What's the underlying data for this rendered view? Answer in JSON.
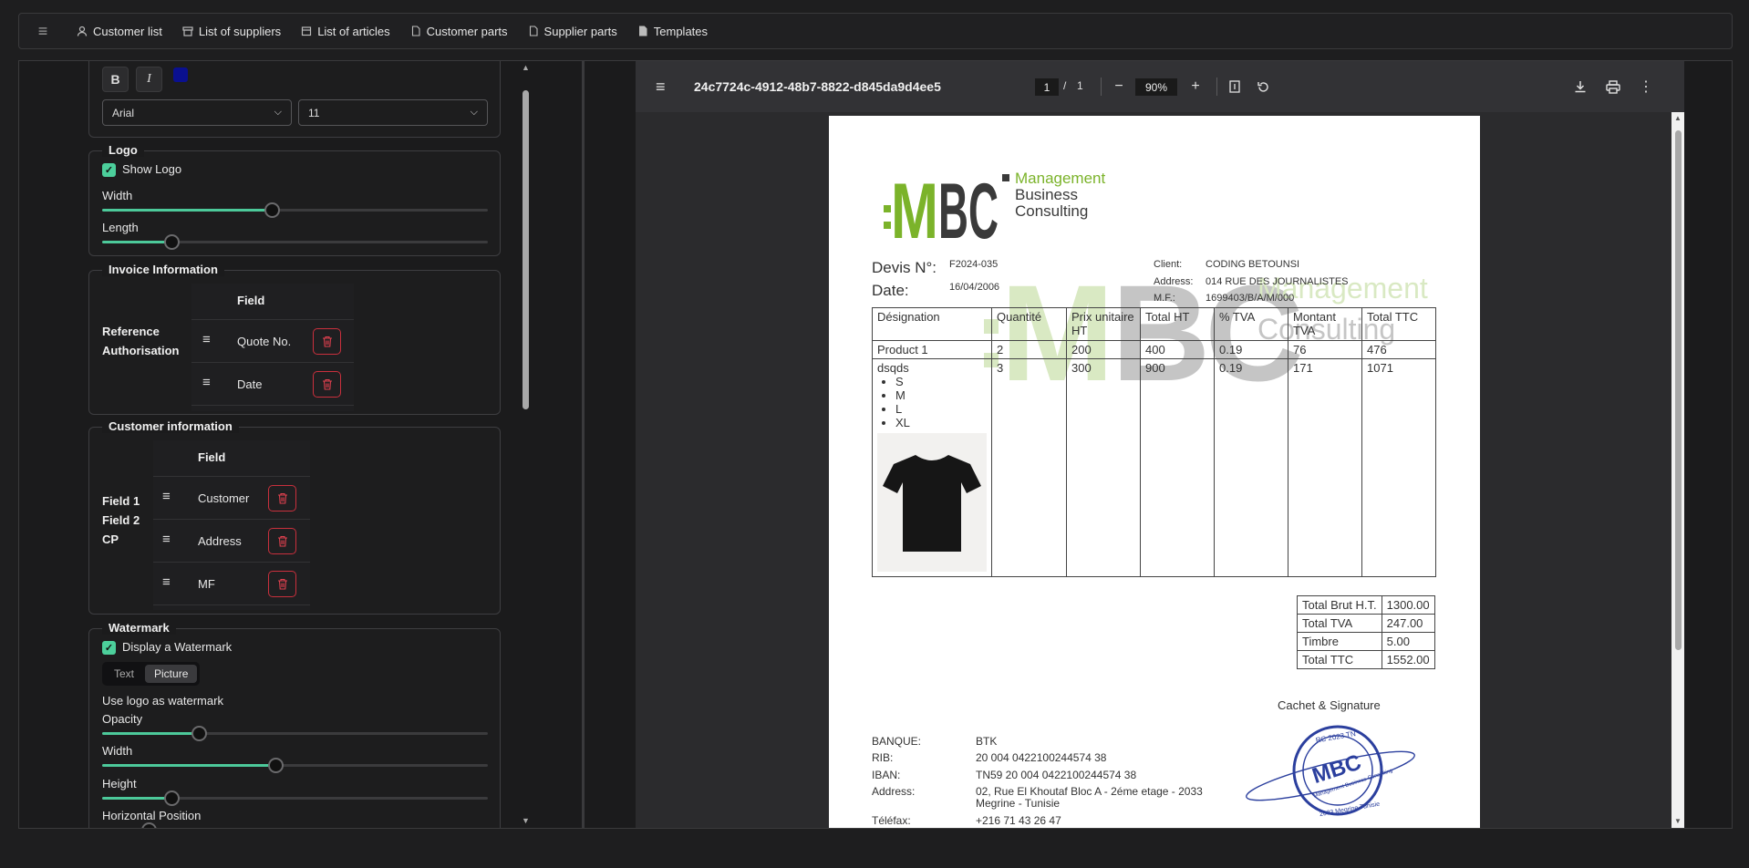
{
  "nav": {
    "items": [
      {
        "label": "Customer list",
        "icon": "user-icon"
      },
      {
        "label": "List of suppliers",
        "icon": "store-icon"
      },
      {
        "label": "List of articles",
        "icon": "box-icon"
      },
      {
        "label": "Customer parts",
        "icon": "document-icon"
      },
      {
        "label": "Supplier parts",
        "icon": "document-icon"
      },
      {
        "label": "Templates",
        "icon": "file-icon"
      }
    ]
  },
  "style": {
    "bold": "B",
    "italic": "I",
    "color": "#0a108f",
    "font": "Arial",
    "size": "11"
  },
  "logo": {
    "title": "Logo",
    "show_label": "Show Logo",
    "show": true,
    "width_label": "Width",
    "width_value": 0.44,
    "length_label": "Length",
    "length_value": 0.18
  },
  "invoice": {
    "title": "Invoice Information",
    "group_labels": [
      "Reference",
      "Authorisation"
    ],
    "header": "Field",
    "fields": [
      "Quote No.",
      "Date"
    ]
  },
  "customer": {
    "title": "Customer information",
    "group_labels": [
      "Field 1",
      "Field 2",
      "CP"
    ],
    "header": "Field",
    "fields": [
      "Customer",
      "Address",
      "MF"
    ]
  },
  "watermark": {
    "title": "Watermark",
    "display_label": "Display a Watermark",
    "display": true,
    "mode_text": "Text",
    "mode_picture": "Picture",
    "use_logo_label": "Use logo as watermark",
    "opacity_label": "Opacity",
    "opacity_value": 0.25,
    "width_label": "Width",
    "width_value": 0.45,
    "height_label": "Height",
    "height_value": 0.18,
    "hpos_label": "Horizontal Position",
    "hpos_value": 0.12
  },
  "pdf": {
    "filename": "24c7724c-4912-48b7-8822-d845da9d4ee5",
    "page_current": "1",
    "page_sep": "/",
    "page_total": "1",
    "zoom": "90%"
  },
  "doc": {
    "logo_mark": ":MBC",
    "logo_line1": "Management",
    "logo_line2": "Business",
    "logo_line3": "Consulting",
    "devis_label": "Devis N°:",
    "devis_value": "F2024-035",
    "date_label": "Date:",
    "date_value": "16/04/2006",
    "client_label": "Client:",
    "client_value": "CODING BETOUNSI",
    "address_label": "Address:",
    "address_value": "014 RUE DES JOURNALISTES",
    "mf_label": "M.F.:",
    "mf_value": "1699403/B/A/M/000",
    "columns": [
      "Désignation",
      "Quantité",
      "Prix unitaire HT",
      "Total HT",
      "% TVA",
      "Montant TVA",
      "Total TTC"
    ],
    "rows": [
      {
        "designation": "Product 1",
        "qty": "2",
        "price": "200",
        "total_ht": "400",
        "tva": "0.19",
        "montant_tva": "76",
        "total_ttc": "476"
      },
      {
        "designation": "dsqds",
        "qty": "3",
        "price": "300",
        "total_ht": "900",
        "tva": "0.19",
        "montant_tva": "171",
        "total_ttc": "1071"
      }
    ],
    "sizes": [
      "S",
      "M",
      "L",
      "XL"
    ],
    "totals": [
      {
        "label": "Total Brut H.T.",
        "value": "1300.00"
      },
      {
        "label": "Total TVA",
        "value": "247.00"
      },
      {
        "label": "Timbre",
        "value": "5.00"
      },
      {
        "label": "Total TTC",
        "value": "1552.00"
      }
    ],
    "signature_label": "Cachet & Signature",
    "bank_label": "BANQUE:",
    "bank_value": "BTK",
    "rib_label": "RIB:",
    "rib_value": "20 004 0422100244574 38",
    "iban_label": "IBAN:",
    "iban_value": "TN59 20 004 0422100244574 38",
    "addr_label": "Address:",
    "addr_value_1": "02, Rue El Khoutaf Bloc A - 2éme etage - 2033",
    "addr_value_2": "Megrine - Tunisie",
    "fax_label": "Téléfax:",
    "fax_value": "+216 71 43 26 47",
    "stamp_top": "RC 2023 TN",
    "stamp_mark": "MBC",
    "stamp_sub": "Management Business Consulting",
    "stamp_bottom": "2033 Megrine Tunisie"
  }
}
